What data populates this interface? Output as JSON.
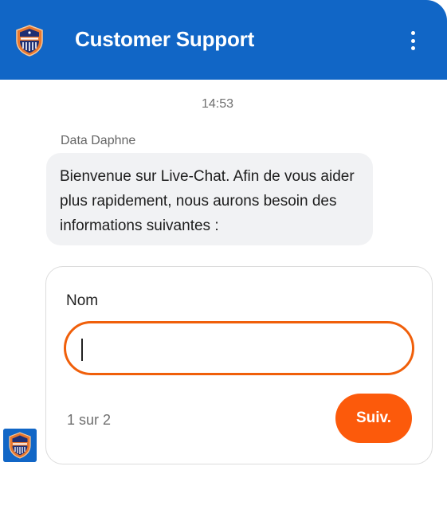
{
  "header": {
    "title": "Customer Support",
    "logo_icon": "shield-badge-icon",
    "menu_icon": "more-vertical-icon",
    "background_color": "#1166c6"
  },
  "conversation": {
    "timestamp": "14:53",
    "sender_name": "Data Daphne",
    "message": "Bienvenue sur Live-Chat. Afin de vous aider plus rapidement, nous aurons besoin des informations suivantes :",
    "avatar_icon": "shield-badge-icon"
  },
  "form": {
    "field_label": "Nom",
    "field_value": "",
    "field_placeholder": "",
    "step_indicator": "1 sur 2",
    "next_label": "Suiv.",
    "accent_color": "#fc5a0b"
  }
}
